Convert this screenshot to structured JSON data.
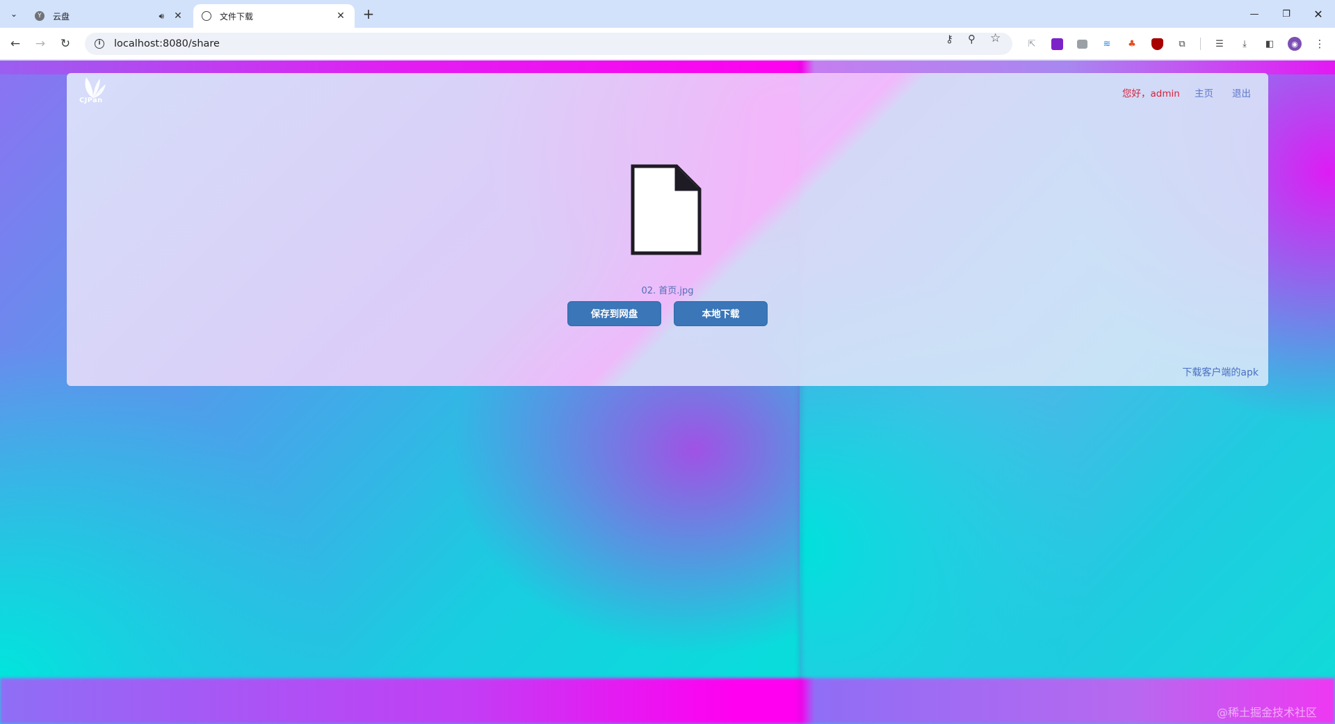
{
  "browser": {
    "tabs": [
      {
        "title": "云盘",
        "favicon_label": "Y",
        "active": false,
        "audio": true
      },
      {
        "title": "文件下载",
        "active": true
      }
    ],
    "address": "localhost:8080/share"
  },
  "page": {
    "logo_text": "CJPan",
    "greeting": "您好，admin",
    "nav": {
      "home": "主页",
      "logout": "退出"
    },
    "file_name": "02. 首页.jpg",
    "buttons": {
      "save_to_disk": "保存到网盘",
      "local_download": "本地下载"
    },
    "apk_link": "下载客户端的apk"
  },
  "watermark": "@稀土掘金技术社区",
  "colors": {
    "button_bg": "#3a76b8",
    "greeting": "#d7213a",
    "link": "#5b78c8",
    "active_tab": "#ffffff",
    "tab_strip": "#d3e2fb"
  }
}
